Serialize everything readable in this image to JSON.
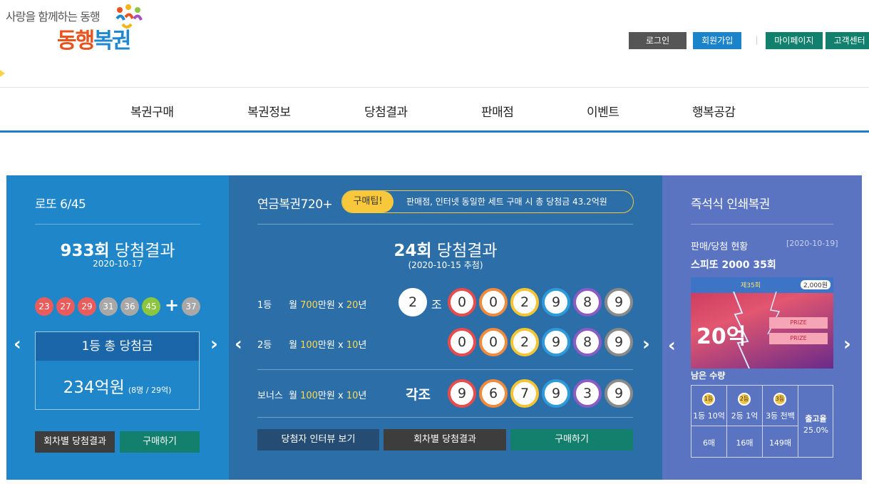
{
  "brand": {
    "tagline": "사랑을 함께하는 동행",
    "name_a": "동행",
    "name_b": "복권"
  },
  "util_nav": {
    "login": "로그인",
    "join": "회원가입",
    "mypage": "마이페이지",
    "support": "고객센터"
  },
  "gnb": [
    "복권구매",
    "복권정보",
    "당첨결과",
    "판매점",
    "이벤트",
    "행복공감"
  ],
  "lotto": {
    "title": "로또 6/45",
    "round": "933회",
    "result_word": "당첨결과",
    "date": "2020-10-17",
    "balls": [
      "23",
      "27",
      "29",
      "31",
      "36",
      "45"
    ],
    "plus": "+",
    "bonus": "37",
    "prize_head": "1등 총 당첨금",
    "prize_amount": "234억원",
    "prize_detail": "(8명 / 29억)",
    "btn_history": "회차별 당첨결과",
    "btn_buy": "구매하기"
  },
  "pension": {
    "title": "연금복권720+",
    "tip_badge": "구매팁!",
    "tip_text": "판매점, 인터넷 동일한 세트 구매 시 총 당첨금 43.2억원",
    "round": "24회",
    "result_word": "당첨결과",
    "date": "(2020-10-15 추첨)",
    "rank1": {
      "label": "1등",
      "pre": "월 ",
      "amount": "700",
      "unit": "만원 x ",
      "years": "20",
      "suffix": "년",
      "group": "2",
      "jo": "조",
      "numbers": [
        "0",
        "0",
        "2",
        "9",
        "8",
        "9"
      ]
    },
    "rank2": {
      "label": "2등",
      "pre": "월 ",
      "amount": "100",
      "unit": "만원 x ",
      "years": "10",
      "suffix": "년",
      "numbers": [
        "0",
        "0",
        "2",
        "9",
        "8",
        "9"
      ]
    },
    "bonus": {
      "label": "보너스",
      "pre": "월 ",
      "amount": "100",
      "unit": "만원 x ",
      "years": "10",
      "suffix": "년",
      "group_text": "각조",
      "numbers": [
        "9",
        "6",
        "7",
        "9",
        "3",
        "9"
      ]
    },
    "btn_interview": "당첨자 인터뷰 보기",
    "btn_history": "회차별 당첨결과",
    "btn_buy": "구매하기"
  },
  "instant": {
    "title": "즉석식 인쇄복권",
    "status_label": "판매/당첨 현황",
    "status_date": "[2020-10-19]",
    "product": "스피또 2000 35회",
    "card": {
      "round": "제35회",
      "price": "2,000원",
      "big": "20억",
      "prize": "PRIZE"
    },
    "remain_label": "남은 수량",
    "ranks": [
      {
        "medal": "1등",
        "label": "1등 10억",
        "count": "6매"
      },
      {
        "medal": "2등",
        "label": "2등 1억",
        "count": "16매"
      },
      {
        "medal": "3등",
        "label": "3등 천백",
        "count": "149매"
      }
    ],
    "ratio_label": "출고율",
    "ratio_value": "25.0%"
  },
  "colors": {
    "ball_red": "#ea5b5b",
    "ball_gray": "#a8a8a8",
    "ball_green": "#8cc63f",
    "nball": [
      "#e84b4b",
      "#f08a3c",
      "#f3c535",
      "#2f9ad8",
      "#8a5cc4",
      "#8a8a8a"
    ]
  }
}
